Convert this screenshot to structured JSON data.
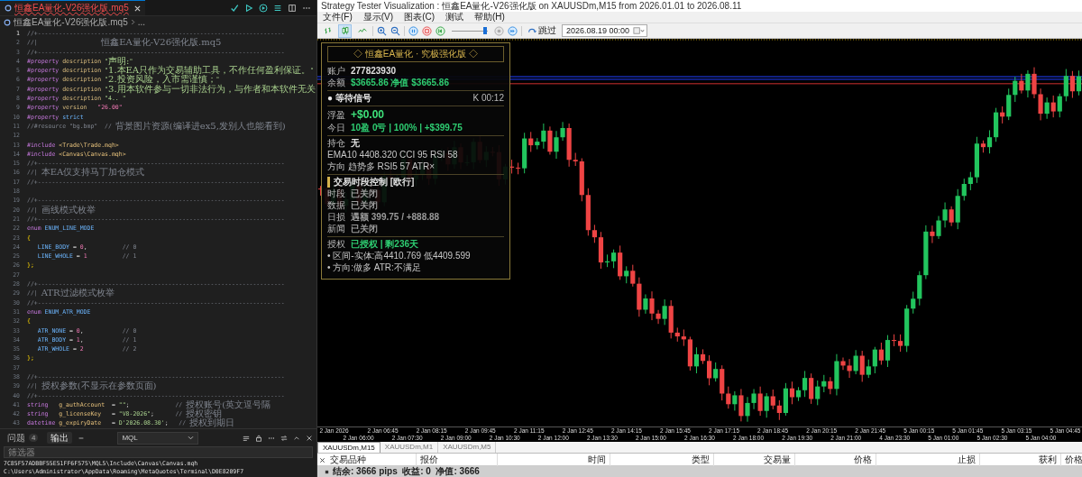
{
  "ide": {
    "tab": {
      "label": "恒鑫EA量化-V26强化版.mq5",
      "has_errors": true
    },
    "breadcrumb": [
      "恒鑫EA量化-V26强化版.mq5",
      "..."
    ],
    "lines": [
      {
        "number": "1",
        "tokens": [
          {
            "kind": "comment",
            "text": "//+----------------------------------------------------------------------"
          }
        ]
      },
      {
        "number": "2",
        "tokens": [
          {
            "kind": "comment",
            "text": "//|                  "
          },
          {
            "kind": "comment",
            "text": "恒鑫EA量化-V26强化版.mq5",
            "wide": true
          }
        ]
      },
      {
        "number": "3",
        "tokens": [
          {
            "kind": "comment",
            "text": "//+----------------------------------------------------------------------"
          }
        ]
      },
      {
        "number": "4",
        "tokens": [
          {
            "kind": "directive",
            "text": "#property "
          },
          {
            "kind": "keyword",
            "text": "description "
          },
          {
            "kind": "string",
            "text": "\""
          },
          {
            "kind": "string",
            "text": "声明:",
            "wide": true
          },
          {
            "kind": "string",
            "text": "\""
          }
        ]
      },
      {
        "number": "5",
        "tokens": [
          {
            "kind": "directive",
            "text": "#property "
          },
          {
            "kind": "keyword",
            "text": "description "
          },
          {
            "kind": "string",
            "text": "\""
          },
          {
            "kind": "string",
            "text": "1.本EA只作为交易辅助工具，不作任何盈利保证。",
            "wide": true
          },
          {
            "kind": "string",
            "text": "\""
          }
        ]
      },
      {
        "number": "6",
        "tokens": [
          {
            "kind": "directive",
            "text": "#property "
          },
          {
            "kind": "keyword",
            "text": "description "
          },
          {
            "kind": "string",
            "text": "\""
          },
          {
            "kind": "string",
            "text": "2.投资风险，入市需谨慎；",
            "wide": true
          },
          {
            "kind": "string",
            "text": "\""
          }
        ]
      },
      {
        "number": "7",
        "tokens": [
          {
            "kind": "directive",
            "text": "#property "
          },
          {
            "kind": "keyword",
            "text": "description "
          },
          {
            "kind": "string",
            "text": "\""
          },
          {
            "kind": "string",
            "text": "3.用本软件参与一切非法行为，与作者和本软件无关",
            "wide": true
          }
        ]
      },
      {
        "number": "8",
        "tokens": [
          {
            "kind": "directive",
            "text": "#property "
          },
          {
            "kind": "keyword",
            "text": "description "
          },
          {
            "kind": "string",
            "text": "\"4.. \""
          }
        ]
      },
      {
        "number": "9",
        "tokens": [
          {
            "kind": "directive",
            "text": "#property "
          },
          {
            "kind": "keyword",
            "text": "version   "
          },
          {
            "kind": "number",
            "text": "\"26.00\""
          }
        ]
      },
      {
        "number": "10",
        "tokens": [
          {
            "kind": "directive",
            "text": "#property "
          },
          {
            "kind": "ident",
            "text": "strict"
          }
        ]
      },
      {
        "number": "11",
        "tokens": [
          {
            "kind": "comment",
            "text": "//#resource \"bg.bmp\"  // "
          },
          {
            "kind": "comment",
            "text": "背景图片资源(编译进ex5,发别人也能看到)",
            "wide": true
          }
        ]
      },
      {
        "number": "12"
      },
      {
        "number": "13",
        "tokens": [
          {
            "kind": "directive",
            "text": "#include "
          },
          {
            "kind": "path",
            "text": "<Trade\\Trade.mqh>"
          }
        ]
      },
      {
        "number": "14",
        "tokens": [
          {
            "kind": "directive",
            "text": "#include "
          },
          {
            "kind": "path",
            "text": "<Canvas\\Canvas.mqh>"
          }
        ]
      },
      {
        "number": "15",
        "tokens": [
          {
            "kind": "comment",
            "text": "//+----------------------------------------------------------------------"
          }
        ]
      },
      {
        "number": "16",
        "tokens": [
          {
            "kind": "comment",
            "text": "//| "
          },
          {
            "kind": "comment",
            "text": "本EA仅支持马丁加仓模式",
            "wide": true
          }
        ]
      },
      {
        "number": "17",
        "tokens": [
          {
            "kind": "comment",
            "text": "//+----------------------------------------------------------------------"
          }
        ]
      },
      {
        "number": "18"
      },
      {
        "number": "19",
        "tokens": [
          {
            "kind": "comment",
            "text": "//+----------------------------------------------------------------------"
          }
        ]
      },
      {
        "number": "20",
        "tokens": [
          {
            "kind": "comment",
            "text": "//| "
          },
          {
            "kind": "comment",
            "text": "画线模式枚举",
            "wide": true
          }
        ]
      },
      {
        "number": "21",
        "tokens": [
          {
            "kind": "comment",
            "text": "//+----------------------------------------------------------------------"
          }
        ]
      },
      {
        "number": "22",
        "tokens": [
          {
            "kind": "type",
            "text": "enum "
          },
          {
            "kind": "ident",
            "text": "ENUM_LINE_MODE"
          }
        ]
      },
      {
        "number": "23",
        "tokens": [
          {
            "kind": "punct",
            "text": "{"
          }
        ]
      },
      {
        "number": "24",
        "tokens": [
          {
            "kind": "ident",
            "text": "   LINE_BODY"
          },
          {
            "kind": "plain",
            "text": " = "
          },
          {
            "kind": "number",
            "text": "0"
          },
          {
            "kind": "plain",
            "text": ",          "
          },
          {
            "kind": "comment",
            "text": "// 0"
          }
        ]
      },
      {
        "number": "25",
        "tokens": [
          {
            "kind": "ident",
            "text": "   LINE_WHOLE"
          },
          {
            "kind": "plain",
            "text": " = "
          },
          {
            "kind": "number",
            "text": "1"
          },
          {
            "kind": "comment",
            "text": "          // 1"
          }
        ]
      },
      {
        "number": "26",
        "tokens": [
          {
            "kind": "punct",
            "text": "};"
          }
        ]
      },
      {
        "number": "27"
      },
      {
        "number": "28",
        "tokens": [
          {
            "kind": "comment",
            "text": "//+----------------------------------------------------------------------"
          }
        ]
      },
      {
        "number": "29",
        "tokens": [
          {
            "kind": "comment",
            "text": "//| "
          },
          {
            "kind": "comment",
            "text": "ATR过滤模式枚举",
            "wide": true
          }
        ]
      },
      {
        "number": "30",
        "tokens": [
          {
            "kind": "comment",
            "text": "//+----------------------------------------------------------------------"
          }
        ]
      },
      {
        "number": "31",
        "tokens": [
          {
            "kind": "type",
            "text": "enum "
          },
          {
            "kind": "ident",
            "text": "ENUM_ATR_MODE"
          }
        ]
      },
      {
        "number": "32",
        "tokens": [
          {
            "kind": "punct",
            "text": "{"
          }
        ]
      },
      {
        "number": "33",
        "tokens": [
          {
            "kind": "ident",
            "text": "   ATR_NONE"
          },
          {
            "kind": "plain",
            "text": " = "
          },
          {
            "kind": "number",
            "text": "0"
          },
          {
            "kind": "plain",
            "text": ",           "
          },
          {
            "kind": "comment",
            "text": "// 0"
          }
        ]
      },
      {
        "number": "34",
        "tokens": [
          {
            "kind": "ident",
            "text": "   ATR_BODY"
          },
          {
            "kind": "plain",
            "text": " = "
          },
          {
            "kind": "number",
            "text": "1"
          },
          {
            "kind": "plain",
            "text": ",           "
          },
          {
            "kind": "comment",
            "text": "// 1"
          }
        ]
      },
      {
        "number": "35",
        "tokens": [
          {
            "kind": "ident",
            "text": "   ATR_WHOLE"
          },
          {
            "kind": "plain",
            "text": " = "
          },
          {
            "kind": "number",
            "text": "2"
          },
          {
            "kind": "comment",
            "text": "           // 2"
          }
        ]
      },
      {
        "number": "36",
        "tokens": [
          {
            "kind": "punct",
            "text": "};"
          }
        ]
      },
      {
        "number": "37"
      },
      {
        "number": "38",
        "tokens": [
          {
            "kind": "comment",
            "text": "//+----------------------------------------------------------------------"
          }
        ]
      },
      {
        "number": "39",
        "tokens": [
          {
            "kind": "comment",
            "text": "//| "
          },
          {
            "kind": "comment",
            "text": "授权参数(不显示在参数页面)",
            "wide": true
          }
        ]
      },
      {
        "number": "40",
        "tokens": [
          {
            "kind": "comment",
            "text": "//+----------------------------------------------------------------------"
          }
        ]
      },
      {
        "number": "41",
        "tokens": [
          {
            "kind": "type",
            "text": "string   "
          },
          {
            "kind": "var",
            "text": "g_authAccount"
          },
          {
            "kind": "plain",
            "text": "  = "
          },
          {
            "kind": "string",
            "text": "\"\""
          },
          {
            "kind": "plain",
            "text": ";             "
          },
          {
            "kind": "comment",
            "text": "// "
          },
          {
            "kind": "comment",
            "text": "授权账号(英文逗号隔",
            "wide": true
          }
        ]
      },
      {
        "number": "42",
        "tokens": [
          {
            "kind": "type",
            "text": "string   "
          },
          {
            "kind": "var",
            "text": "g_licenseKey"
          },
          {
            "kind": "plain",
            "text": "   = "
          },
          {
            "kind": "string",
            "text": "\"V8-2026\""
          },
          {
            "kind": "plain",
            "text": ";      "
          },
          {
            "kind": "comment",
            "text": "// "
          },
          {
            "kind": "comment",
            "text": "授权密钥",
            "wide": true
          }
        ]
      },
      {
        "number": "43",
        "tokens": [
          {
            "kind": "type",
            "text": "datetime "
          },
          {
            "kind": "var",
            "text": "g_expiryDate"
          },
          {
            "kind": "plain",
            "text": "   = "
          },
          {
            "kind": "string",
            "text": "D'2026.08.30'"
          },
          {
            "kind": "plain",
            "text": ";   "
          },
          {
            "kind": "comment",
            "text": "// "
          },
          {
            "kind": "comment",
            "text": "授权到期日",
            "wide": true
          }
        ]
      }
    ],
    "panel": {
      "tabs": [
        {
          "label": "问题",
          "badge": "4",
          "selected": false
        },
        {
          "label": "输出",
          "selected": true
        }
      ],
      "channel": "MQL",
      "filter_placeholder": "筛选器",
      "output": [
        "7C85F57ADBBF55E51FF6F575\\MQL5\\Include\\Canvas\\Canvas.mqh",
        "C:\\Users\\Administrator\\AppData\\Roaming\\MetaQuotes\\Terminal\\D0E8209F7"
      ]
    }
  },
  "tester": {
    "title": "Strategy Tester Visualization : 恒鑫EA量化-V26强化版 on XAUUSDm,M15 from 2026.01.01 to 2026.08.11",
    "menu": [
      "文件(F)",
      "显示(V)",
      "图表(C)",
      "测试",
      "帮助(H)"
    ],
    "chart_types": [
      {
        "kind": "bars",
        "selected": false
      },
      {
        "kind": "candles",
        "selected": true
      },
      {
        "kind": "line",
        "selected": false
      }
    ],
    "speed": {
      "level": 0.93
    },
    "skip_label": "跳过",
    "date": "2026.08.19 00:00",
    "info_panel": {
      "title": "◇ 恒鑫EA量化 · 究极强化版 ◇",
      "sections": [
        {
          "rows": [
            {
              "kind": "pair",
              "label": "账户",
              "value": "277823930",
              "color": "#e0e0e0"
            },
            {
              "kind": "pair",
              "label": "余额",
              "value": "$3665.86 净值 $3665.86",
              "color": "#2ecc71"
            }
          ]
        },
        {
          "rows": [
            {
              "kind": "signal",
              "label": "● 等待信号",
              "value": "K 00:12"
            }
          ]
        },
        {
          "rows": [
            {
              "kind": "amount",
              "label": "浮盈",
              "value": "+$0.00",
              "color": "#3ee07a"
            },
            {
              "kind": "pair",
              "label": "今日",
              "value": "10盈 0亏 | 100% | +$399.75",
              "color": "#2ecc71"
            }
          ]
        },
        {
          "rows": [
            {
              "kind": "pair",
              "label": "持仓",
              "value": "无",
              "color": "#e0e0e0"
            },
            {
              "kind": "line",
              "text": "EMA10 4408.320   CCI 95   RSI 58"
            },
            {
              "kind": "line",
              "text": "方向 趋势多   RSI5 57   ATR×"
            }
          ]
        },
        {
          "rows": [
            {
              "kind": "section",
              "text": "交易时段控制 [欧行]"
            },
            {
              "kind": "pair",
              "label": "时段",
              "value": "已关闭",
              "color": "#9a9a9a"
            },
            {
              "kind": "pair",
              "label": "数据",
              "value": "已关闭",
              "color": "#9a9a9a"
            },
            {
              "kind": "pair",
              "label": "日损",
              "value": "遇额 399.75 / +888.88",
              "color": "#9a9a9a"
            },
            {
              "kind": "pair",
              "label": "新闻",
              "value": "已关闭",
              "color": "#9a9a9a"
            }
          ]
        },
        {
          "rows": [
            {
              "kind": "pair",
              "label": "授权",
              "value": "已授权 | 剩236天",
              "color": "#2ecc71"
            },
            {
              "kind": "line",
              "text": "• 区间-实体:高4410.769 低4409.599"
            },
            {
              "kind": "line",
              "text": "• 方向:做多 ATR:不满足"
            }
          ]
        }
      ]
    },
    "time_axis": [
      "2 Jan 2026",
      "2 Jan 06:00",
      "2 Jan 06:45",
      "2 Jan 07:30",
      "2 Jan 08:15",
      "2 Jan 09:00",
      "2 Jan 09:45",
      "2 Jan 10:30",
      "2 Jan 11:15",
      "2 Jan 12:00",
      "2 Jan 12:45",
      "2 Jan 13:30",
      "2 Jan 14:15",
      "2 Jan 15:00",
      "2 Jan 15:45",
      "2 Jan 16:30",
      "2 Jan 17:15",
      "2 Jan 18:00",
      "2 Jan 18:45",
      "2 Jan 19:30",
      "2 Jan 20:15",
      "2 Jan 21:00",
      "2 Jan 21:45",
      "4 Jan 23:30",
      "5 Jan 00:15",
      "5 Jan 01:00",
      "5 Jan 01:45",
      "5 Jan 02:30",
      "5 Jan 03:15",
      "5 Jan 04:00",
      "5 Jan 04:45"
    ],
    "chart_tabs": [
      {
        "label": "XAUUSDm,M15",
        "selected": true
      },
      {
        "label": "XAUUSDm,M1",
        "selected": false
      },
      {
        "label": "XAUUSDm,M5",
        "selected": false
      }
    ],
    "columns": [
      "交易品种",
      "报价",
      "时间",
      "类型",
      "交易量",
      "价格",
      "止损",
      "获利",
      "价格"
    ],
    "summary": "结余: 3666 pips  收益: 0  净值: 3666"
  }
}
